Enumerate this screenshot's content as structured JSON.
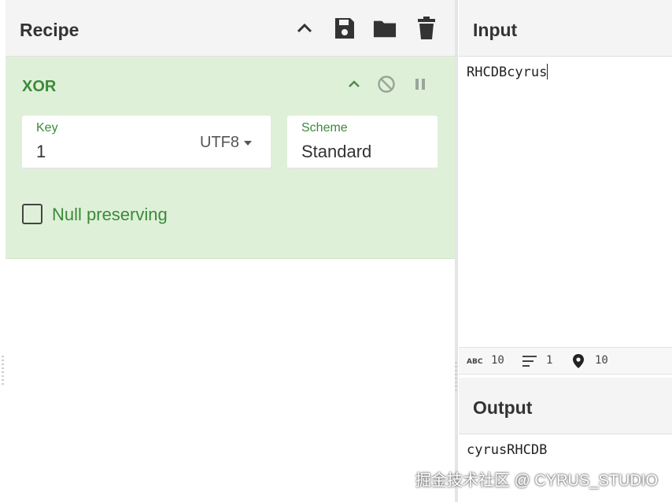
{
  "recipe": {
    "title": "Recipe",
    "icons": [
      "chevron-up-icon",
      "save-icon",
      "folder-icon",
      "trash-icon"
    ]
  },
  "operation": {
    "name": "XOR",
    "key": {
      "label": "Key",
      "value": "1",
      "encoding": "UTF8"
    },
    "scheme": {
      "label": "Scheme",
      "value": "Standard"
    },
    "null_preserving": {
      "label": "Null preserving",
      "checked": false
    }
  },
  "input": {
    "title": "Input",
    "text": "RHCDBcyrus",
    "stats": {
      "length": "10",
      "lines": "1",
      "position": "10"
    }
  },
  "output": {
    "title": "Output",
    "text": "cyrusRHCDB"
  },
  "watermark": "掘金技术社区 @ CYRUS_STUDIO",
  "colors": {
    "operation_bg": "#dff0d8",
    "operation_text": "#3a8a3a",
    "header_bg": "#f4f4f4"
  }
}
